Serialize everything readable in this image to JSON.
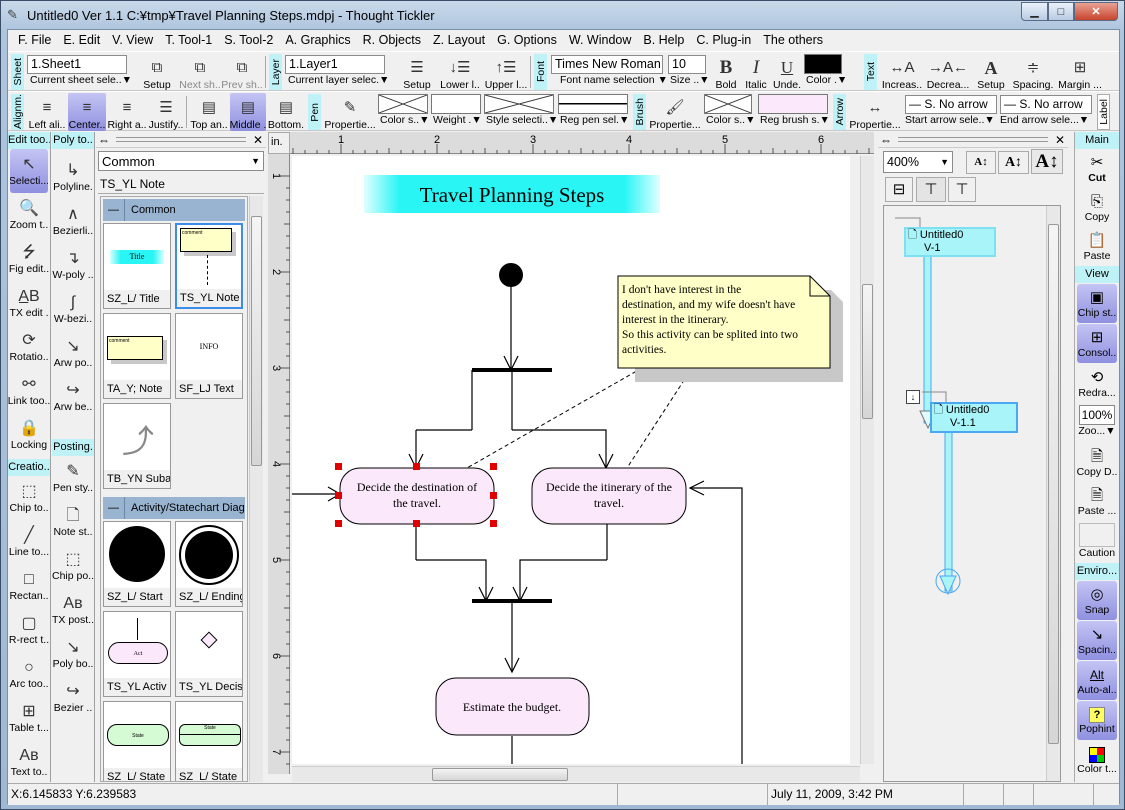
{
  "window": {
    "title": "Untitled0 Ver 1.1 C:¥tmp¥Travel Planning Steps.mdpj - Thought Tickler",
    "minimize": "▁",
    "maximize": "□",
    "close": "✕"
  },
  "menu": [
    "F. File",
    "E. Edit",
    "V. View",
    "T. Tool-1",
    "S. Tool-2",
    "A. Graphics",
    "R. Objects",
    "Z. Layout",
    "G. Options",
    "W. Window",
    "B. Help",
    "C. Plug-in",
    "The others"
  ],
  "toolbar1": {
    "sheet_label": "Sheet",
    "sheet_value": "1.Sheet1",
    "sheet_caption": "Current sheet sele..▼",
    "sheet_setup": "Setup",
    "next_sheet": "Next sh..",
    "prev_sheet": "Prev sh..",
    "layer_label": "Layer",
    "layer_value": "1.Layer1",
    "layer_caption": "Current layer selec.▼",
    "layer_setup": "Setup",
    "lower_layer": "Lower l..",
    "upper_layer": "Upper l...",
    "font_label": "Font",
    "font_name": "Times New Roman",
    "font_name_caption": "Font name selection  ▼",
    "font_size": "10",
    "font_size_caption": "Size ..▼",
    "bold": "Bold",
    "italic": "Italic",
    "underline": "Unde.",
    "color": "Color .▼",
    "text_label": "Text",
    "increase": "Increas..",
    "decrease": "Decrea...",
    "text_setup": "Setup",
    "spacing": "Spacing.",
    "margin": "Margin ..."
  },
  "toolbar2": {
    "align_label": "Alignm.",
    "left_align": "Left ali..",
    "center": "Center..",
    "right_align": "Right a..",
    "justify": "Justify..",
    "top_anchor": "Top an..",
    "middle": "Middle .",
    "bottom": "Bottom.",
    "pen_label": "Pen",
    "pen_properties": "Propertie...",
    "pen_color": "Color s..▼",
    "pen_weight": "Weight .▼",
    "pen_style": "Style selecti..▼",
    "reg_pen": "Reg pen sel.▼",
    "brush_label": "Brush",
    "brush_properties": "Propertie...",
    "brush_color": "Color s..▼",
    "reg_brush": "Reg brush s.▼",
    "arrow_label": "Arrow",
    "arrow_properties": "Propertie...",
    "start_arrow_value": "— S. No arrow",
    "start_arrow": "Start arrow sele..▼",
    "end_arrow_value": "— S. No arrow",
    "end_arrow": "End arrow sele...▼",
    "label_label": "Label"
  },
  "edit_tools": {
    "header": "Edit too..",
    "items": [
      {
        "label": "Selecti...",
        "icon": "pointer-icon",
        "glyph": "↖"
      },
      {
        "label": "Zoom t..",
        "icon": "magnifier-icon",
        "glyph": "🔍"
      },
      {
        "label": "Fig edit..",
        "icon": "fig-edit-icon",
        "glyph": "⭍"
      },
      {
        "label": "TX edit .",
        "icon": "text-edit-icon",
        "glyph": "A̲B"
      },
      {
        "label": "Rotatio..",
        "icon": "rotation-icon",
        "glyph": "⟳"
      },
      {
        "label": "Link too..",
        "icon": "link-icon",
        "glyph": "⚯"
      },
      {
        "label": "Locking",
        "icon": "lock-icon",
        "glyph": "🔒"
      }
    ]
  },
  "creation_tools": {
    "header": "Creatio..",
    "items": [
      {
        "label": "Chip to..",
        "icon": "chip-tool-icon",
        "glyph": "⬚"
      },
      {
        "label": "Line to...",
        "icon": "line-tool-icon",
        "glyph": "╱"
      },
      {
        "label": "Rectan..",
        "icon": "rectangle-icon",
        "glyph": "□"
      },
      {
        "label": "R-rect t..",
        "icon": "rounded-rect-icon",
        "glyph": "▢"
      },
      {
        "label": "Arc too..",
        "icon": "arc-icon",
        "glyph": "○"
      },
      {
        "label": "Table t...",
        "icon": "table-icon",
        "glyph": "⊞"
      },
      {
        "label": "Text to..",
        "icon": "text-tool-icon",
        "glyph": "Aʙ"
      }
    ]
  },
  "poly_tools": {
    "header": "Poly to..",
    "items": [
      {
        "label": "Polyline.",
        "icon": "polyline-icon",
        "glyph": "↳"
      },
      {
        "label": "Bezierli..",
        "icon": "bezier-icon",
        "glyph": "∧"
      },
      {
        "label": "W-poly ..",
        "icon": "w-poly-icon",
        "glyph": "↴"
      },
      {
        "label": "W-bezi..",
        "icon": "w-bezier-icon",
        "glyph": "∫"
      },
      {
        "label": "Arw po..",
        "icon": "arrow-poly-icon",
        "glyph": "↘"
      },
      {
        "label": "Arw be..",
        "icon": "arrow-bezier-icon",
        "glyph": "↪"
      }
    ]
  },
  "posting_tools": {
    "header": "Posting.",
    "items": [
      {
        "label": "Pen sty..",
        "icon": "pen-style-icon",
        "glyph": "✎"
      },
      {
        "label": "Note st..",
        "icon": "note-style-icon",
        "glyph": "🗋"
      },
      {
        "label": "Chip po..",
        "icon": "chip-post-icon",
        "glyph": "⬚"
      },
      {
        "label": "TX post..",
        "icon": "text-post-icon",
        "glyph": "Aʙ"
      },
      {
        "label": "Poly bo..",
        "icon": "poly-box-icon",
        "glyph": "↘"
      },
      {
        "label": "Bezier ..",
        "icon": "bezier-box-icon",
        "glyph": "↪"
      }
    ]
  },
  "palette": {
    "category": "Common",
    "current": "TS_YL Note",
    "groups": [
      {
        "name": "Common",
        "items": [
          "SZ_L/ Title",
          "TS_YL Note",
          "TA_Y;  Note",
          "SF_LJ Text",
          "TB_YN Suba"
        ]
      },
      {
        "name": "Activity/Statechart Diag",
        "items": [
          "SZ_L/ Start",
          "SZ_L/ Ending",
          "TS_YL Activ",
          "TS_YL Decis",
          "SZ_L/ State",
          "SZ_L/ State"
        ]
      }
    ],
    "thumb_title": "Title",
    "thumb_comment": "comment",
    "thumb_info": "INFO",
    "thumb_act": "Act",
    "thumb_state": "State"
  },
  "canvas": {
    "unit": "in.",
    "h_ruler": [
      "1",
      "2",
      "3",
      "4",
      "5",
      "6"
    ],
    "v_ruler": [
      "1",
      "2",
      "3",
      "4",
      "5",
      "6",
      "7"
    ],
    "diagram_title": "Travel Planning Steps",
    "note": [
      "I don't have interest in the",
      "destination, and my wife doesn't have",
      "interest in the itinerary.",
      "So this activity can be splited into two",
      "activities."
    ],
    "activity1": [
      "Decide the destination of",
      "the travel."
    ],
    "activity2": [
      "Decide the itinerary of the",
      "travel."
    ],
    "activity3": "Estimate the budget."
  },
  "navigator": {
    "zoom": "400%",
    "nodes": [
      {
        "title": "Untitled0",
        "version": "V-1"
      },
      {
        "title": "Untitled0",
        "version": "V-1.1"
      }
    ]
  },
  "right_panel": {
    "main_header": "Main",
    "cut": "Cut",
    "copy": "Copy",
    "paste": "Paste",
    "view_header": "View",
    "chip_st": "Chip st..",
    "consol": "Consol..",
    "redraw": "Redra...",
    "zoom_value": "100%",
    "zoom": "Zoo...▼",
    "copy_d": "Copy D..",
    "paste_d": "Paste ...",
    "caution": "Caution",
    "env_header": "Enviro...",
    "snap": "Snap",
    "spacing": "Spacin..",
    "auto_align": "Auto-al..",
    "auto_align_glyph": "Alt",
    "pophint": "Pophint",
    "pophint_glyph": "?",
    "color_t": "Color t..."
  },
  "status": {
    "coords": "X:6.145833 Y:6.239583",
    "datetime": "July 11, 2009, 3:42 PM"
  },
  "colors": {
    "title_band": "#29f5f5",
    "note_fill": "#ffffc8",
    "activity_fill": "#fbe8fb",
    "selection_handle": "#e00000",
    "tool_selected": "#9b9ce4",
    "label_band": "#bff2f7",
    "nav_node": "#a8f4f8"
  }
}
